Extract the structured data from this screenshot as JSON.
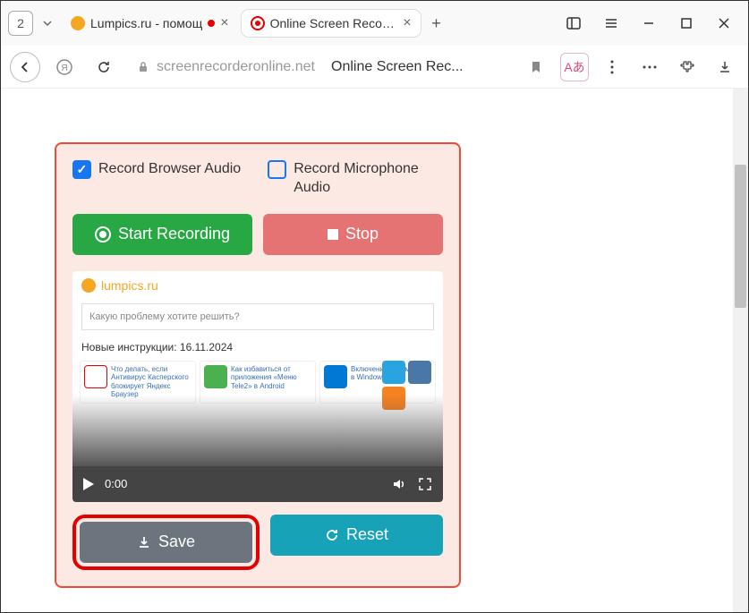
{
  "titlebar": {
    "tab_count": "2",
    "tabs": [
      {
        "title": "Lumpics.ru - помощ",
        "favicon_color": "#f5a623",
        "rec_indicator": true
      },
      {
        "title": "Online Screen Recorder",
        "favicon_color": "#e30000"
      }
    ]
  },
  "addressbar": {
    "domain": "screenrecorderonline.net",
    "page_title": "Online Screen Rec...",
    "translate_label": "Aあ"
  },
  "recorder": {
    "opt_browser_audio": "Record Browser Audio",
    "opt_mic_audio": "Record Microphone Audio",
    "start_label": "Start Recording",
    "stop_label": "Stop",
    "save_label": "Save",
    "reset_label": "Reset"
  },
  "preview": {
    "brand": "lumpics.ru",
    "search_placeholder": "Какую проблему хотите решить?",
    "subtitle": "Новые инструкции: 16.11.2024",
    "time": "0:00",
    "cards": [
      {
        "text": "Что делать, если Антивирус Касперского блокирует Яндекс Браузер",
        "icon_bg": "#fff",
        "icon_fg": "#e30000"
      },
      {
        "text": "Как избавиться от приложения «Меню Tele2» в Android",
        "icon_bg": "#4caf50",
        "icon_fg": "#fff"
      },
      {
        "text": "Включение телеметрии в Windows 10",
        "icon_bg": "#0078d4",
        "icon_fg": "#fff"
      }
    ],
    "social_colors": [
      "#2aa4e0",
      "#4a76a8",
      "#f58220",
      "#fff"
    ]
  }
}
